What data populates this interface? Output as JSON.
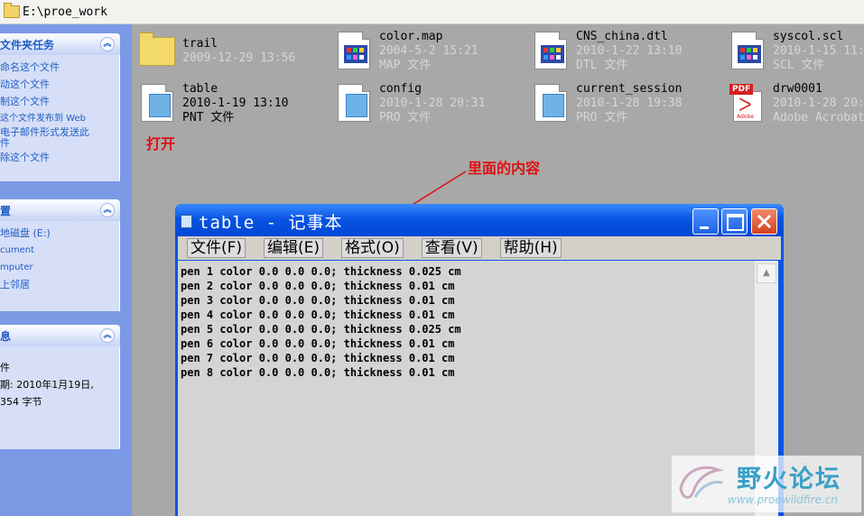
{
  "address": {
    "path": "E:\\proe_work"
  },
  "left_pane": {
    "tasks": {
      "title": "文件夹任务",
      "items": [
        "命名这个文件",
        "动这个文件",
        "制这个文件",
        "这个文件发布到 Web",
        "电子邮件形式发送此",
        "件",
        "除这个文件"
      ]
    },
    "places": {
      "title": "置",
      "items": [
        "地磁盘 (E:)",
        "cument",
        "mputer",
        "上邻居"
      ]
    },
    "details": {
      "title": "息",
      "items": [
        "件",
        "期: 2010年1月19日,",
        "",
        "354 字节"
      ]
    }
  },
  "files": [
    {
      "name": "trail",
      "line2": "2009-12-29 13:56",
      "line3": "",
      "icon": "folder-icon"
    },
    {
      "name": "color.map",
      "line2": "2004-5-2 15:21",
      "line3": "MAP 文件",
      "icon": "document-icon"
    },
    {
      "name": "CNS_china.dtl",
      "line2": "2010-1-22 13:10",
      "line3": "DTL 文件",
      "icon": "document-icon"
    },
    {
      "name": "syscol.scl",
      "line2": "2010-1-15 11:",
      "line3": "SCL 文件",
      "icon": "document-icon"
    },
    {
      "name": "table",
      "line2": "2010-1-19 13:10",
      "line3": "PNT 文件",
      "icon": "pnt-file-icon"
    },
    {
      "name": "config",
      "line2": "2010-1-28 20:31",
      "line3": "PRO 文件",
      "icon": "pro-file-icon"
    },
    {
      "name": "current_session",
      "line2": "2010-1-28 19:38",
      "line3": "PRO 文件",
      "icon": "pro-file-icon"
    },
    {
      "name": "drw0001",
      "line2": "2010-1-28 20:",
      "line3": "Adobe Acrobat",
      "icon": "pdf-icon"
    }
  ],
  "annotations": {
    "open_label": "打开",
    "content_label": "里面的内容"
  },
  "notepad": {
    "title": "table - 记事本",
    "menu": [
      "文件(F)",
      "编辑(E)",
      "格式(O)",
      "查看(V)",
      "帮助(H)"
    ],
    "lines": [
      "pen 1 color 0.0 0.0 0.0; thickness 0.025 cm",
      "pen 2 color 0.0 0.0 0.0; thickness 0.01 cm",
      "pen 3 color 0.0 0.0 0.0; thickness 0.01 cm",
      "pen 4 color 0.0 0.0 0.0; thickness 0.01 cm",
      "pen 5 color 0.0 0.0 0.0; thickness 0.025 cm",
      "pen 6 color 0.0 0.0 0.0; thickness 0.01 cm",
      "pen 7 color 0.0 0.0 0.0; thickness 0.01 cm",
      "pen 8 color 0.0 0.0 0.0; thickness 0.01 cm"
    ]
  },
  "watermark": {
    "name": "野火论坛",
    "url": "www.proewildfire.cn"
  },
  "colors": {
    "titlebar": "#0a55e3",
    "annotation": "#e01010",
    "taskpane": "#7b9ae6"
  }
}
